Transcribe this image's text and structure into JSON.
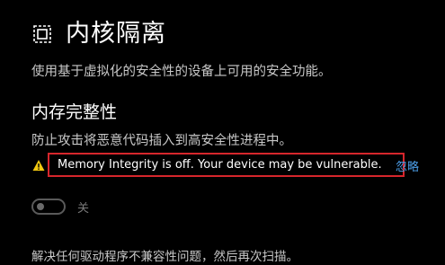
{
  "page": {
    "title": "内核隔离",
    "description": "使用基于虚拟化的安全性的设备上可用的安全功能。",
    "icon": "core-isolation-chip-icon"
  },
  "memory_integrity": {
    "title": "内存完整性",
    "description": "防止攻击将恶意代码插入到高安全性进程中。",
    "warning": {
      "icon": "warning-triangle-icon",
      "text": "Memory Integrity is off. Your device may be vulnerable.",
      "dismiss_label": "忽略",
      "highlight_color": "#d6262c"
    },
    "toggle": {
      "state": "off",
      "label": "关"
    }
  },
  "footer": {
    "text": "解决任何驱动程序不兼容性问题，然后再次扫描。"
  },
  "colors": {
    "background": "#000000",
    "link": "#4c9ee8",
    "warning": "#f2c811"
  }
}
